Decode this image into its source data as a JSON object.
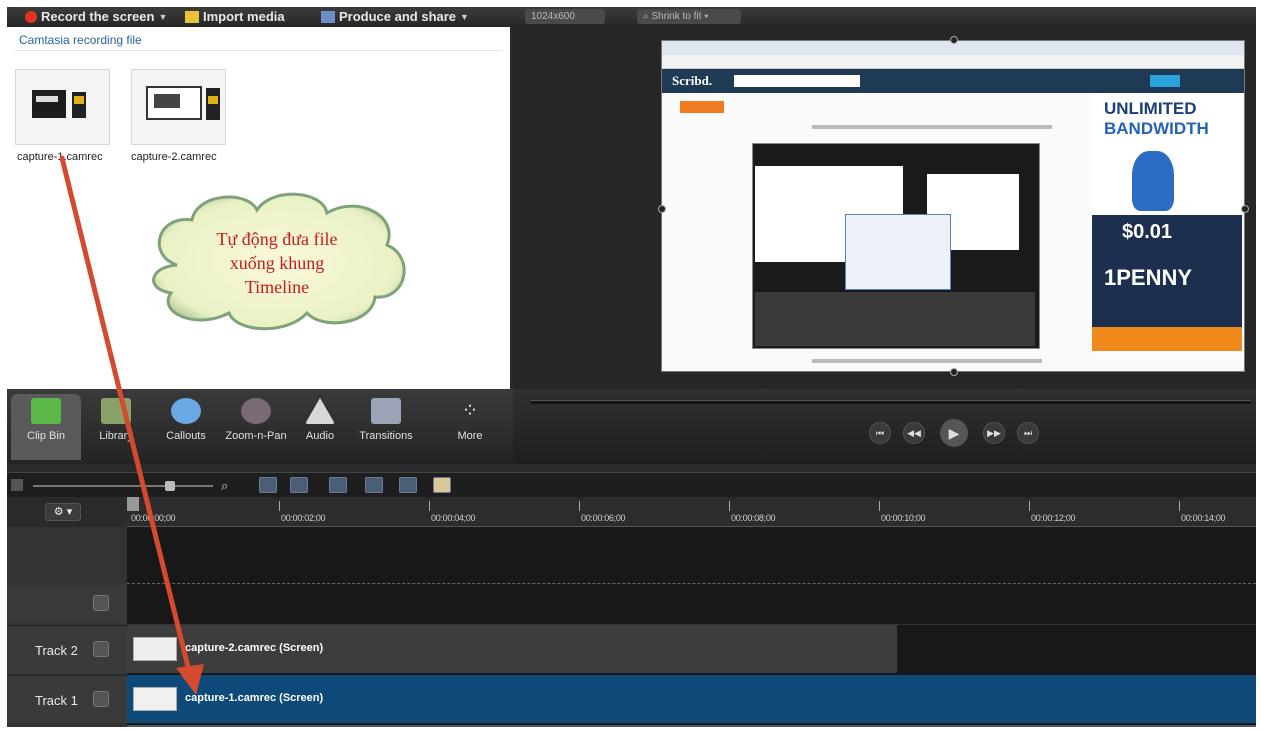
{
  "toolbar": {
    "record_label": "Record the screen",
    "import_label": "Import media",
    "produce_label": "Produce and share",
    "size_label": "1024x600",
    "shrink_label": "Shrink to fit"
  },
  "clip_bin": {
    "header": "Camtasia recording file",
    "items": [
      {
        "name": "capture-1.camrec"
      },
      {
        "name": "capture-2.camrec"
      }
    ]
  },
  "callout": {
    "lines": [
      "Tự động đưa file",
      "xuống khung",
      "Timeline"
    ]
  },
  "preview": {
    "site_logo": "Scribd.",
    "ad_line1": "UNLIMITED",
    "ad_line2": "BANDWIDTH",
    "ad_price": "$0.01",
    "ad_penny": "1PENNY"
  },
  "tabs": [
    {
      "label": "Clip Bin",
      "icon": "film-icon"
    },
    {
      "label": "Library",
      "icon": "library-icon"
    },
    {
      "label": "Callouts",
      "icon": "callout-icon"
    },
    {
      "label": "Zoom-n-Pan",
      "icon": "zoom-icon"
    },
    {
      "label": "Audio",
      "icon": "speaker-icon"
    },
    {
      "label": "Transitions",
      "icon": "transition-icon"
    },
    {
      "label": "More",
      "icon": "more-icon"
    }
  ],
  "timeline": {
    "ruler": [
      "00:00:00;00",
      "00:00:02;00",
      "00:00:04;00",
      "00:00:06;00",
      "00:00:08;00",
      "00:00:10;00",
      "00:00:12;00",
      "00:00:14;00"
    ],
    "tracks": [
      {
        "name": "Track 2",
        "clip": "capture-2.camrec (Screen)"
      },
      {
        "name": "Track 1",
        "clip": "capture-1.camrec (Screen)"
      }
    ]
  },
  "colors": {
    "accent_red": "#d44a2e",
    "callout_text": "#cc1a1a",
    "track1_clip": "#0d4a7a",
    "track2_clip": "#3d3d3d"
  }
}
